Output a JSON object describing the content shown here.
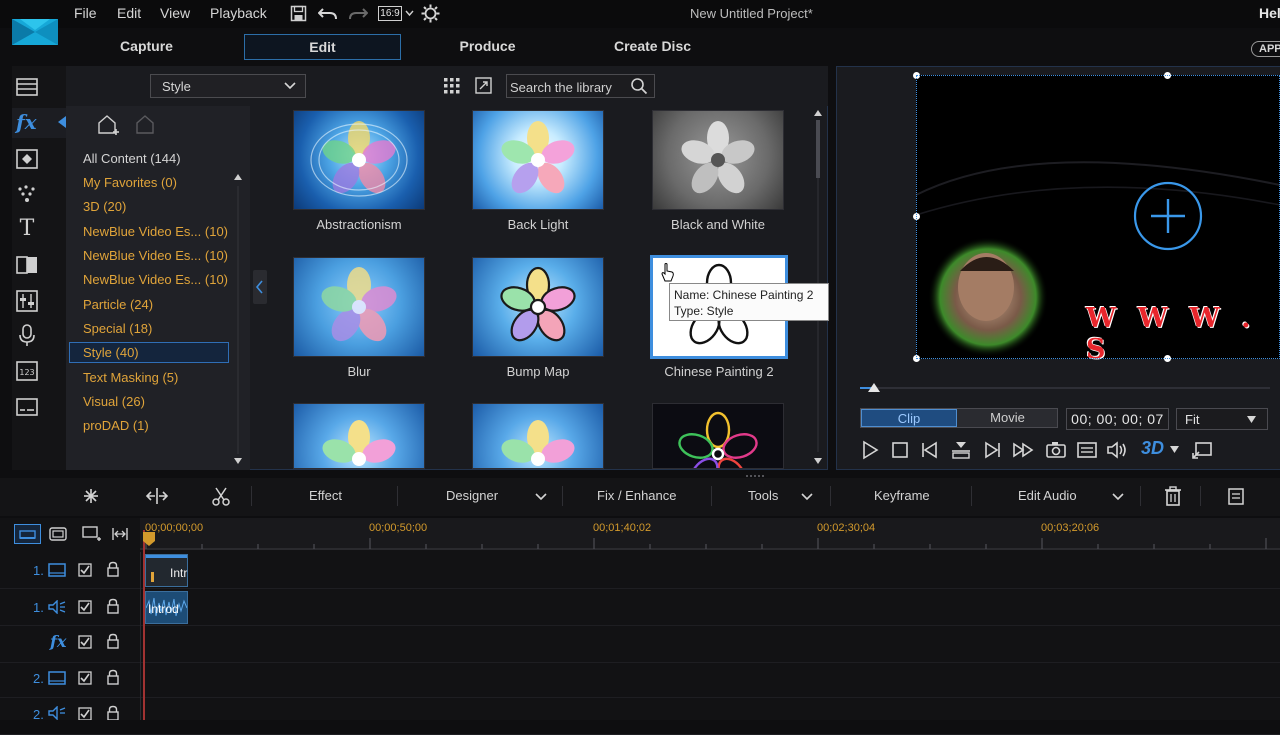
{
  "menu": {
    "items": [
      "File",
      "Edit",
      "View",
      "Playback"
    ],
    "aspect": "16:9",
    "title": "New Untitled Project*",
    "user": "Hel"
  },
  "modes": {
    "tabs": [
      "Capture",
      "Edit",
      "Produce",
      "Create Disc"
    ],
    "active": "Edit",
    "app_button": "APP"
  },
  "library": {
    "filter_select": "Style",
    "search_placeholder": "Search the library",
    "categories": [
      {
        "label": "All Content (144)"
      },
      {
        "label": "My Favorites (0)"
      },
      {
        "label": "3D (20)"
      },
      {
        "label": "NewBlue Video Es... (10)"
      },
      {
        "label": "NewBlue Video Es... (10)"
      },
      {
        "label": "NewBlue Video Es... (10)"
      },
      {
        "label": "Particle (24)"
      },
      {
        "label": "Special (18)"
      },
      {
        "label": "Style (40)"
      },
      {
        "label": "Text Masking (5)"
      },
      {
        "label": "Visual (26)"
      },
      {
        "label": "proDAD (1)"
      }
    ],
    "selected_category": "Style (40)",
    "effects": [
      {
        "name": "Abstractionism"
      },
      {
        "name": "Back Light"
      },
      {
        "name": "Black and White"
      },
      {
        "name": "Blur"
      },
      {
        "name": "Bump Map"
      },
      {
        "name": "Chinese Painting 2"
      }
    ],
    "tooltip": {
      "line1": "Name: Chinese Painting 2",
      "line2": "Type: Style"
    }
  },
  "preview": {
    "clip_label": "Clip",
    "movie_label": "Movie",
    "timecode": "00; 00; 00; 07",
    "zoom": "Fit",
    "overlay_text": "W W W . S",
    "mode_3d": "3D"
  },
  "edit_toolbar": {
    "effect": "Effect",
    "designer": "Designer",
    "fix_enhance": "Fix / Enhance",
    "tools": "Tools",
    "keyframe": "Keyframe",
    "edit_audio": "Edit Audio"
  },
  "timeline": {
    "ruler": [
      "00;00;00;00",
      "00;00;50;00",
      "00;01;40;02",
      "00;02;30;04",
      "00;03;20;06"
    ],
    "tracks": [
      {
        "number": "1.",
        "kind": "video"
      },
      {
        "number": "1.",
        "kind": "audio"
      },
      {
        "number": "",
        "kind": "fx",
        "label": "fx"
      },
      {
        "number": "2.",
        "kind": "video"
      },
      {
        "number": "2.",
        "kind": "audio"
      }
    ],
    "clip_video_label": "Intr",
    "clip_audio_label": "Introd"
  },
  "colors": {
    "accent": "#3e8ede",
    "category_text": "#e0a43a",
    "timecode_ruler": "#d39a2c"
  }
}
